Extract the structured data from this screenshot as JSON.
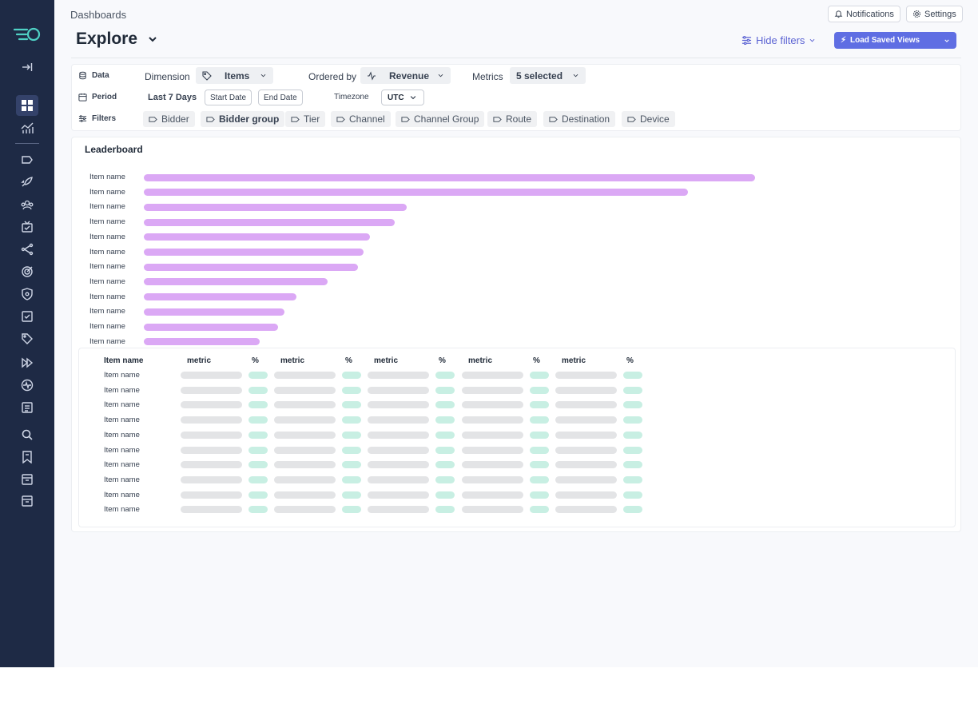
{
  "breadcrumb": "Dashboards",
  "header": {
    "title": "Explore",
    "notifications_label": "Notifications",
    "settings_label": "Settings",
    "hide_filters_label": "Hide filters",
    "load_saved_views_label": "Load Saved Views"
  },
  "sidebar": {
    "icons": [
      "logo",
      "collapse-icon",
      "dashboard-icon",
      "analytics-icon",
      "label-icon",
      "rocket-icon",
      "crowd-icon",
      "tv-icon",
      "share-icon",
      "target-icon",
      "shield-icon",
      "checkbox-icon",
      "tag-icon",
      "fast-forward-icon",
      "pulse-icon",
      "report-icon",
      "search-icon",
      "bookmark-icon",
      "inbox-icon",
      "archive-icon"
    ],
    "active": "dashboard-icon"
  },
  "filters": {
    "data_label": "Data",
    "dimension_label": "Dimension",
    "dimension_value": "Items",
    "ordered_by_label": "Ordered by",
    "ordered_by_value": "Revenue",
    "metrics_label": "Metrics",
    "metrics_value": "5 selected",
    "period_label": "Period",
    "period_value": "Last 7 Days",
    "start_date_label": "Start Date",
    "end_date_label": "End Date",
    "timezone_label": "Timezone",
    "timezone_value": "UTC",
    "filters_label": "Filters",
    "chips": [
      "Bidder",
      "Bidder group",
      "Tier",
      "Channel",
      "Channel Group",
      "Route",
      "Destination",
      "Device"
    ]
  },
  "leaderboard": {
    "title": "Leaderboard",
    "table_headers": [
      "Item name",
      "metric",
      "%",
      "metric",
      "%",
      "metric",
      "%",
      "metric",
      "%",
      "metric",
      "%"
    ],
    "table_rows": [
      "Item name",
      "Item name",
      "Item name",
      "Item name",
      "Item name",
      "Item name",
      "Item name",
      "Item name",
      "Item name",
      "Item name"
    ]
  },
  "chart_data": {
    "type": "bar",
    "orientation": "horizontal",
    "title": "Leaderboard",
    "categories": [
      "Item name",
      "Item name",
      "Item name",
      "Item name",
      "Item name",
      "Item name",
      "Item name",
      "Item name",
      "Item name",
      "Item name",
      "Item name",
      "Item name"
    ],
    "values": [
      100,
      89,
      43,
      41,
      37,
      36,
      35,
      30,
      25,
      23,
      22,
      19
    ],
    "color": "#dba8f5"
  },
  "colors": {
    "sidebar": "#1e2a45",
    "accent": "#5f6ee3",
    "logo": "#4fd1c5"
  }
}
